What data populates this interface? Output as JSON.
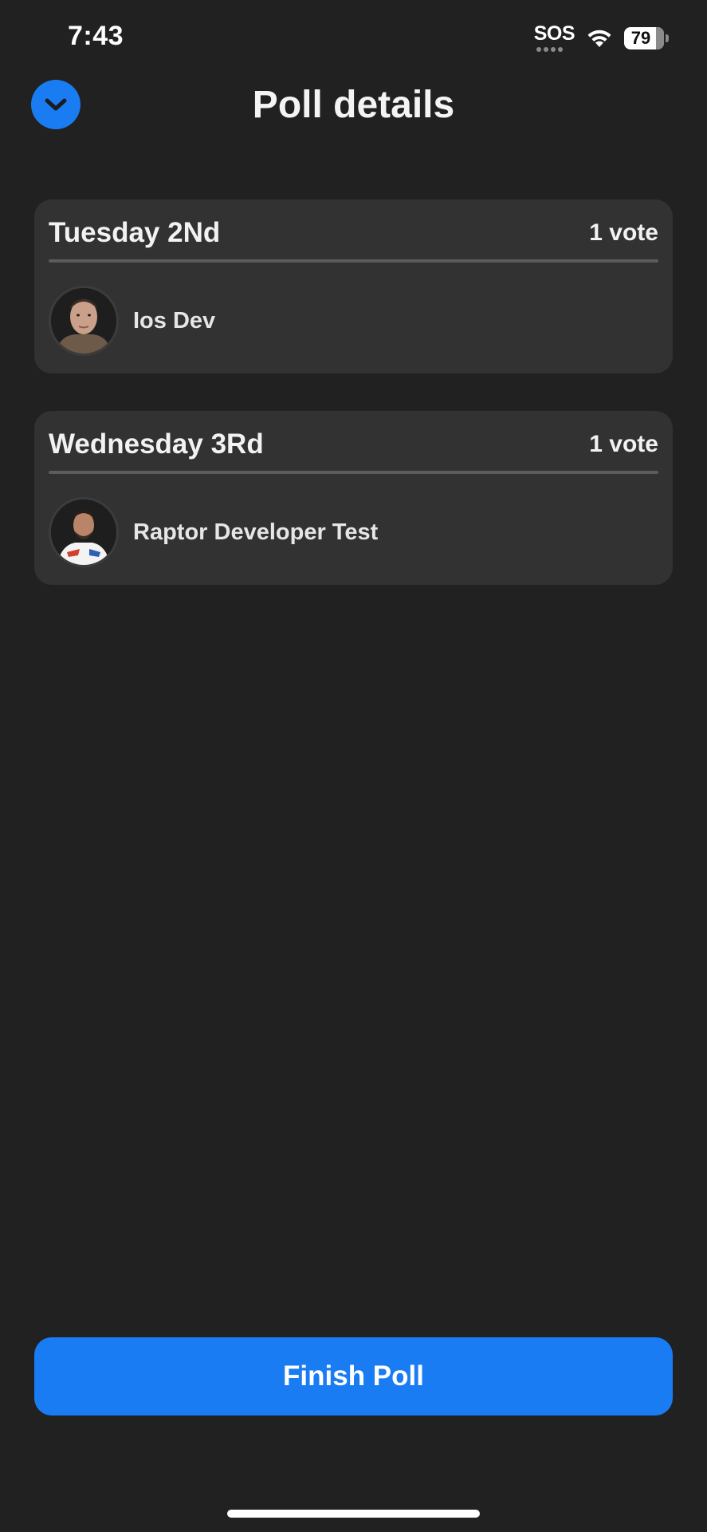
{
  "status_bar": {
    "time": "7:43",
    "sos": "SOS",
    "battery": "79",
    "wifi_icon": "wifi-icon"
  },
  "header": {
    "title": "Poll details",
    "back_icon": "chevron-down-icon",
    "accent_color": "#1a7cf3"
  },
  "options": [
    {
      "label": "Tuesday 2Nd",
      "votes": "1 vote",
      "voters": [
        {
          "name": "Ios Dev"
        }
      ]
    },
    {
      "label": "Wednesday 3Rd",
      "votes": "1 vote",
      "voters": [
        {
          "name": "Raptor Developer Test"
        }
      ]
    }
  ],
  "footer": {
    "finish_label": "Finish Poll"
  }
}
